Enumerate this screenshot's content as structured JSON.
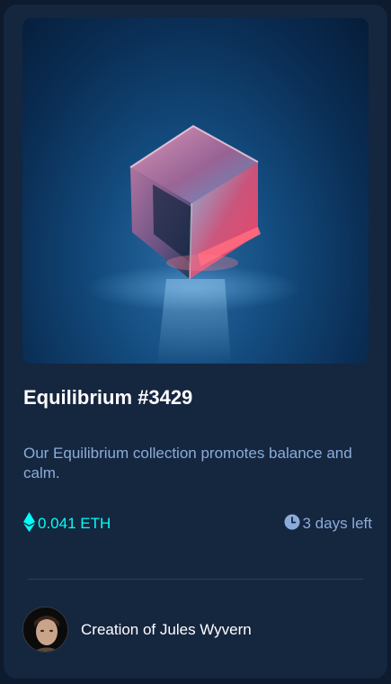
{
  "card": {
    "image": {
      "subject": "glowing-glass-cube"
    },
    "title": "Equilibrium #3429",
    "description": "Our Equilibrium collection promotes balance and calm.",
    "price": {
      "icon": "ethereum-icon",
      "label": "0.041 ETH"
    },
    "time_left": {
      "icon": "clock-icon",
      "label": "3 days left"
    },
    "creator": {
      "prefix": "Creation of",
      "name": "Jules Wyvern",
      "text": "Creation of Jules Wyvern"
    }
  },
  "colors": {
    "background": "#0e1a2e",
    "card": "#15263f",
    "accent_cyan": "#00fff8",
    "soft_blue": "#8bacd9",
    "divider": "#2e405a",
    "white": "#ffffff"
  }
}
